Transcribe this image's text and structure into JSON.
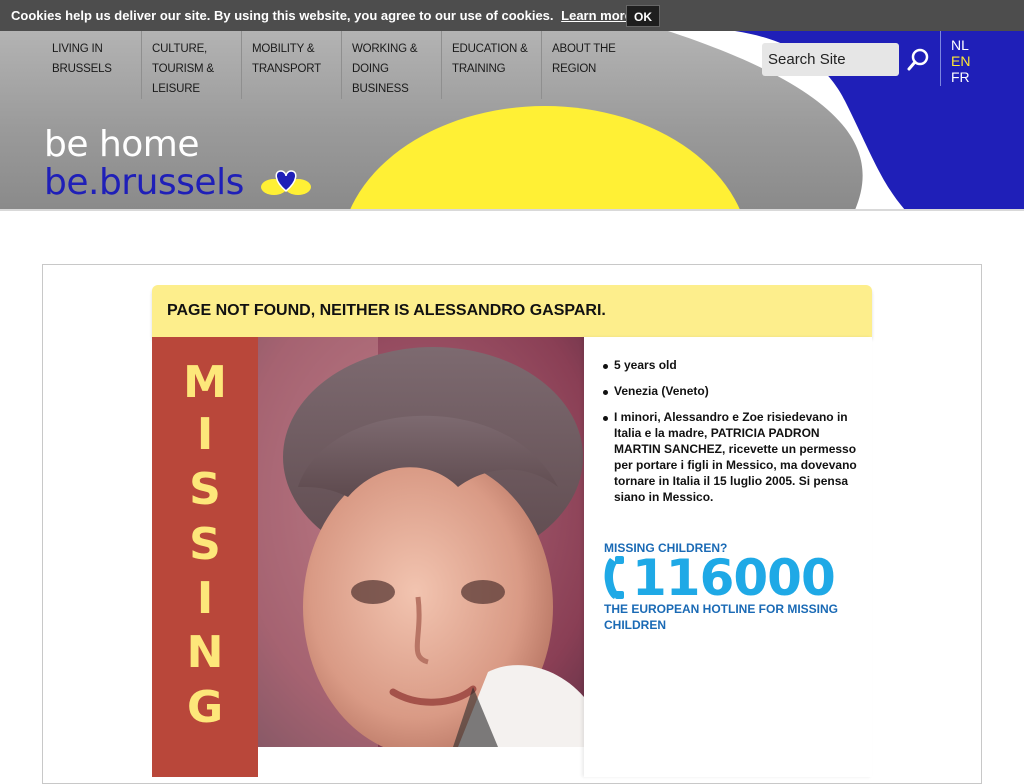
{
  "cookie": {
    "text": "Cookies help us deliver our site. By using this website, you agree to our use of cookies.",
    "link": "Learn more",
    "ok": "OK"
  },
  "nav": {
    "items": [
      {
        "label": "LIVING IN BRUSSELS"
      },
      {
        "label": "CULTURE, TOURISM & LEISURE"
      },
      {
        "label": "MOBILITY & TRANSPORT"
      },
      {
        "label": "WORKING & DOING BUSINESS"
      },
      {
        "label": "EDUCATION & TRAINING"
      },
      {
        "label": "ABOUT THE REGION"
      }
    ]
  },
  "search": {
    "placeholder": "Search Site",
    "icon": "search-icon"
  },
  "languages": {
    "nl": "NL",
    "en": "EN",
    "fr": "FR",
    "active": "EN"
  },
  "logo": {
    "line1": "be home",
    "line2": "be.brussels",
    "icon": "heart-icon"
  },
  "banner": {
    "title": "PAGE NOT FOUND, NEITHER IS ALESSANDRO GASPARI."
  },
  "missing": {
    "letters": [
      "M",
      "I",
      "S",
      "S",
      "I",
      "N",
      "G"
    ]
  },
  "child": {
    "age": "5 years old",
    "place": "Venezia (Veneto)",
    "description": "I minori, Alessandro e Zoe risiedevano in Italia e la madre, PATRICIA PADRON MARTIN SANCHEZ, ricevette un permesso per portare i figli in Messico, ma dovevano tornare in Italia il 15 luglio 2005. Si pensa siano in Messico."
  },
  "hotline": {
    "question": "MISSING CHILDREN?",
    "number": "116000",
    "subtitle": "THE EUROPEAN HOTLINE FOR MISSING CHILDREN",
    "icon": "phone-icon"
  },
  "colors": {
    "header_blue": "#1f1fb8",
    "header_yellow": "#fff035",
    "missing_red": "#b9473a",
    "missing_letters": "#fde77a",
    "banner_yellow": "#fdee8c",
    "hotline_blue": "#1fa9e6"
  }
}
